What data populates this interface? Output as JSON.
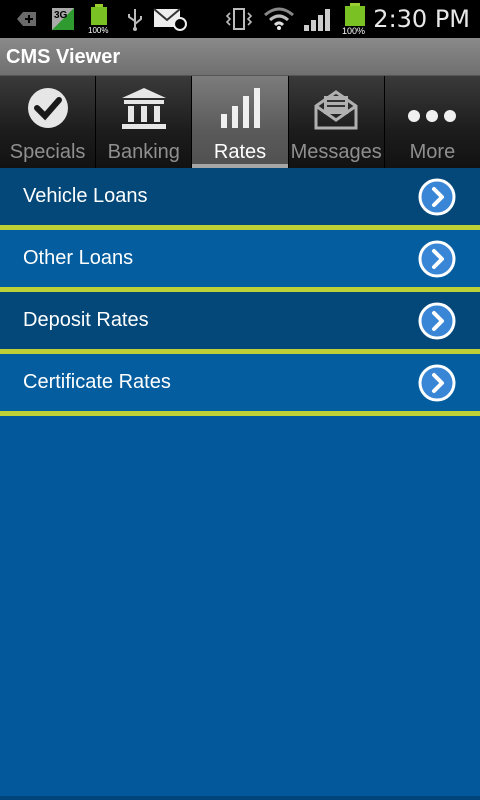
{
  "status_bar": {
    "time": "2:30 PM",
    "network": "3G",
    "battery_small": "100%",
    "battery_large": "100%",
    "icons": [
      "back-icon",
      "network-3g-icon",
      "battery-icon",
      "usb-icon",
      "email-icon",
      "vibrate-icon",
      "wifi-icon",
      "signal-icon",
      "battery-icon"
    ]
  },
  "app": {
    "title": "CMS Viewer"
  },
  "tabs": [
    {
      "label": "Specials",
      "icon": "checkmark-icon",
      "active": false
    },
    {
      "label": "Banking",
      "icon": "bank-icon",
      "active": false
    },
    {
      "label": "Rates",
      "icon": "bar-chart-icon",
      "active": true
    },
    {
      "label": "Messages",
      "icon": "envelope-icon",
      "active": false
    },
    {
      "label": "More",
      "icon": "more-dots-icon",
      "active": false
    }
  ],
  "rates_menu": {
    "items": [
      {
        "label": "Vehicle Loans",
        "icon": "chevron-right-icon"
      },
      {
        "label": "Other Loans",
        "icon": "chevron-right-icon"
      },
      {
        "label": "Deposit Rates",
        "icon": "chevron-right-icon"
      },
      {
        "label": "Certificate Rates",
        "icon": "chevron-right-icon"
      }
    ]
  },
  "colors": {
    "background": "#02589a",
    "row_dark": "#034879",
    "row_light": "#045d9e",
    "divider": "#bdd137",
    "chevron": "#3a86d6"
  }
}
